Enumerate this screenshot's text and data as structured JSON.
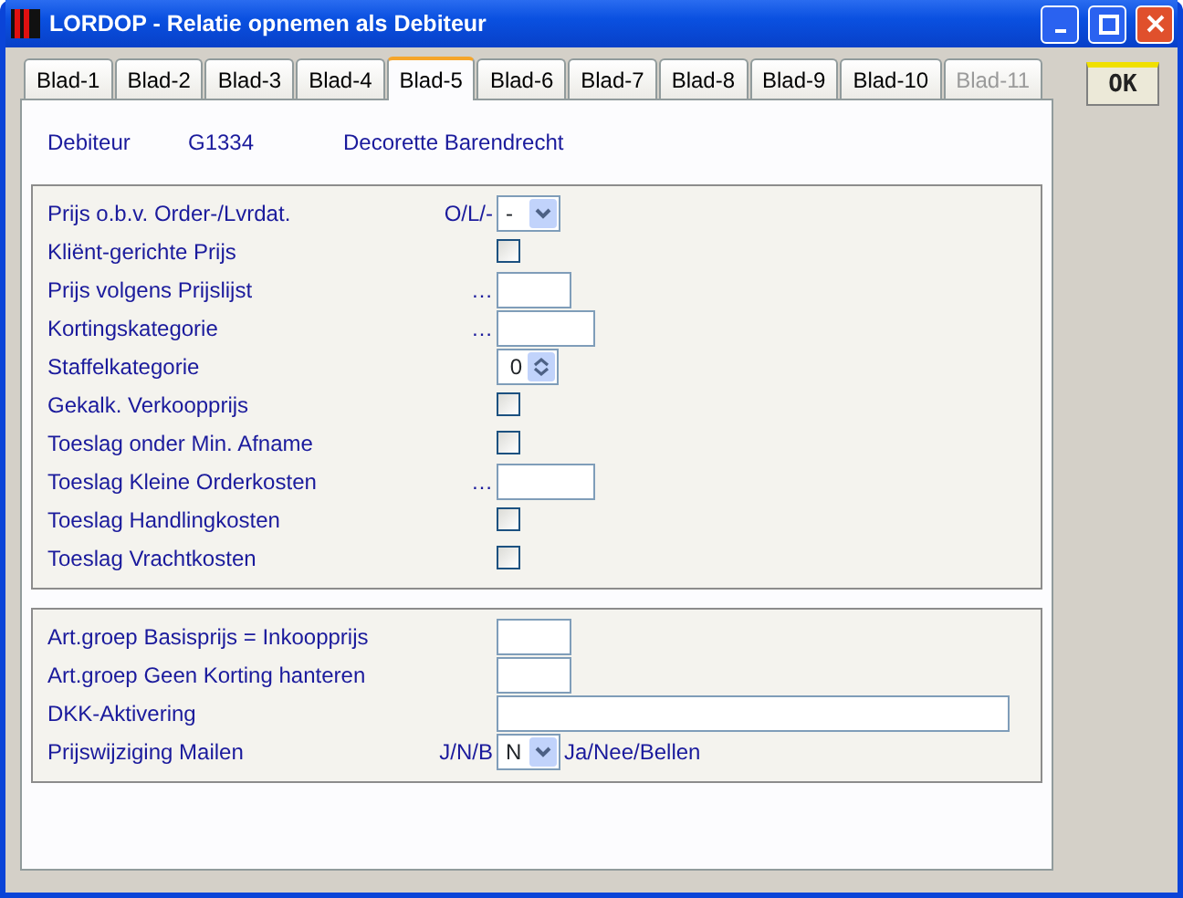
{
  "window": {
    "title": "LORDOP - Relatie opnemen als Debiteur"
  },
  "tabs": [
    {
      "label": "Blad-1",
      "selected": false,
      "disabled": false
    },
    {
      "label": "Blad-2",
      "selected": false,
      "disabled": false
    },
    {
      "label": "Blad-3",
      "selected": false,
      "disabled": false
    },
    {
      "label": "Blad-4",
      "selected": false,
      "disabled": false
    },
    {
      "label": "Blad-5",
      "selected": true,
      "disabled": false
    },
    {
      "label": "Blad-6",
      "selected": false,
      "disabled": false
    },
    {
      "label": "Blad-7",
      "selected": false,
      "disabled": false
    },
    {
      "label": "Blad-8",
      "selected": false,
      "disabled": false
    },
    {
      "label": "Blad-9",
      "selected": false,
      "disabled": false
    },
    {
      "label": "Blad-10",
      "selected": false,
      "disabled": false
    },
    {
      "label": "Blad-11",
      "selected": false,
      "disabled": true
    }
  ],
  "ok_button": {
    "label": "OK"
  },
  "debtor": {
    "label": "Debiteur",
    "code": "G1334",
    "name": "Decorette Barendrecht"
  },
  "sections": [
    {
      "rows": [
        {
          "label": "Prijs o.b.v. Order-/Lvrdat.",
          "hint": "O/L/-",
          "kind": "select",
          "value": "-"
        },
        {
          "label": "Kliënt-gerichte Prijs",
          "kind": "checkbox",
          "checked": false
        },
        {
          "label": "Prijs volgens Prijslijst",
          "hint": "…",
          "kind": "short_input"
        },
        {
          "label": "Kortingskategorie",
          "hint": "…",
          "kind": "medium_input"
        },
        {
          "label": "Staffelkategorie",
          "kind": "spinner",
          "value": "0"
        },
        {
          "label": "Gekalk. Verkoopprijs",
          "kind": "checkbox",
          "checked": false
        },
        {
          "label": "Toeslag onder Min. Afname",
          "kind": "checkbox",
          "checked": false
        },
        {
          "label": "Toeslag Kleine Orderkosten",
          "hint": "…",
          "kind": "medium_input"
        },
        {
          "label": "Toeslag Handlingkosten",
          "kind": "checkbox",
          "checked": false
        },
        {
          "label": "Toeslag Vrachtkosten",
          "kind": "checkbox",
          "checked": false
        }
      ]
    },
    {
      "rows": [
        {
          "label": "Art.groep Basisprijs = Inkoopprijs",
          "kind": "short_input"
        },
        {
          "label": "Art.groep Geen Korting hanteren",
          "kind": "short_input"
        },
        {
          "label": "DKK-Aktivering",
          "kind": "long_input"
        },
        {
          "label": "Prijswijziging Mailen",
          "hint": "J/N/B",
          "kind": "select",
          "value": "N",
          "note": "Ja/Nee/Bellen"
        }
      ]
    }
  ]
}
